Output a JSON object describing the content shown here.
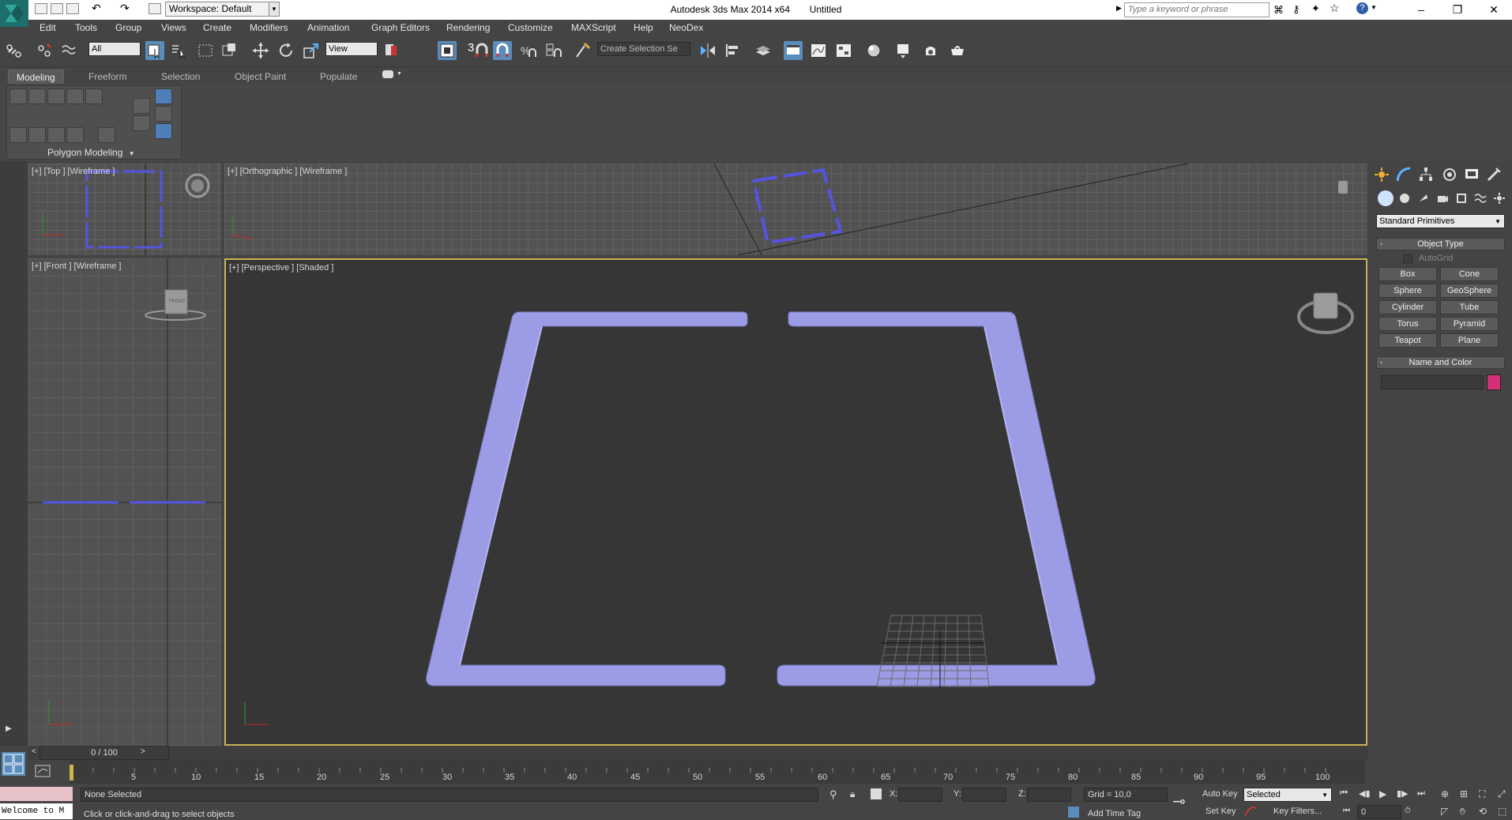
{
  "titlebar": {
    "workspace": "Workspace: Default",
    "app_title": "Autodesk 3ds Max  2014 x64",
    "doc_title": "Untitled",
    "search_placeholder": "Type a keyword or phrase"
  },
  "menu": [
    "Edit",
    "Tools",
    "Group",
    "Views",
    "Create",
    "Modifiers",
    "Animation",
    "Graph Editors",
    "Rendering",
    "Customize",
    "MAXScript",
    "Help",
    "NeoDex"
  ],
  "toolbar": {
    "filter_value": "All",
    "refcoord_value": "View",
    "selection_set_placeholder": "Create Selection Se",
    "snap_number": "3"
  },
  "ribbon": {
    "tabs": [
      "Modeling",
      "Freeform",
      "Selection",
      "Object Paint",
      "Populate"
    ],
    "active_tab": "Modeling",
    "panel_label": "Polygon Modeling"
  },
  "viewports": {
    "top": "[+] [Top ] [Wireframe ]",
    "ortho": "[+] [Orthographic ] [Wireframe ]",
    "front": "[+] [Front ] [Wireframe ]",
    "persp": "[+] [Perspective ] [Shaded ]",
    "front_cube": "FRONT"
  },
  "command_panel": {
    "category": "Standard Primitives",
    "object_type_title": "Object Type",
    "autogrid": "AutoGrid",
    "buttons": [
      "Box",
      "Cone",
      "Sphere",
      "GeoSphere",
      "Cylinder",
      "Tube",
      "Torus",
      "Pyramid",
      "Teapot",
      "Plane"
    ],
    "name_color_title": "Name and Color",
    "object_color": "#d4307a"
  },
  "timeline": {
    "slider": "0 / 100",
    "ticks": [
      "5",
      "10",
      "15",
      "20",
      "25",
      "30",
      "35",
      "40",
      "45",
      "50",
      "55",
      "60",
      "65",
      "70",
      "75",
      "80",
      "85",
      "90",
      "95",
      "100"
    ]
  },
  "status": {
    "maxscript": "Welcome to M",
    "selection": "None Selected",
    "prompt": "Click or click-and-drag to select objects",
    "x_label": "X:",
    "y_label": "Y:",
    "z_label": "Z:",
    "grid": "Grid = 10,0",
    "add_time_tag": "Add Time Tag",
    "auto_key": "Auto Key",
    "set_key": "Set Key",
    "key_mode": "Selected",
    "key_filters": "Key Filters...",
    "frame": "0"
  },
  "colors": {
    "object": "#9c9ce6",
    "viewport_active_border": "#c8b454",
    "wire_object": "#5454e0"
  }
}
